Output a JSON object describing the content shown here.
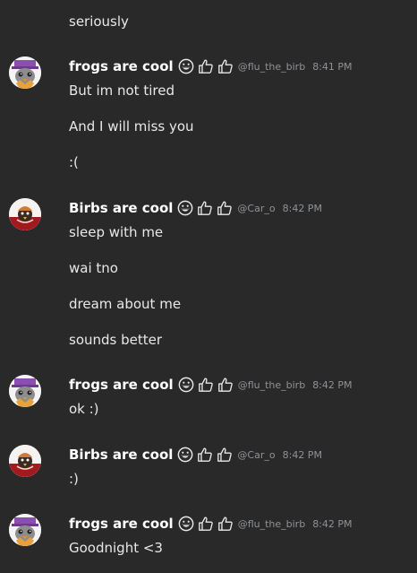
{
  "messages": [
    {
      "text": "seriously"
    },
    {
      "author": "frogs are cool",
      "handle": "@flu_the_birb",
      "time": "8:41 PM",
      "lines": [
        "But im not tired",
        "And I will miss you",
        ":("
      ]
    },
    {
      "author": "Birbs are cool",
      "handle": "@Car_o",
      "time": "8:42 PM",
      "lines": [
        "sleep with me",
        "wai tno",
        "dream about me",
        "sounds better"
      ]
    },
    {
      "author": "frogs are cool",
      "handle": "@flu_the_birb",
      "time": "8:42 PM",
      "lines": [
        "ok :)"
      ]
    },
    {
      "author": "Birbs are cool",
      "handle": "@Car_o",
      "time": "8:42 PM",
      "lines": [
        ":)"
      ]
    },
    {
      "author": "frogs are cool",
      "handle": "@flu_the_birb",
      "time": "8:42 PM",
      "lines": [
        "Goodnight <3"
      ]
    }
  ],
  "badges": [
    "grin-emoji-icon",
    "thumbs-up-icon",
    "thumbs-up-icon"
  ],
  "colors": {
    "background": "#292929",
    "author": "#ffffff",
    "message": "#e8e8e8",
    "meta": "#8e9297"
  }
}
